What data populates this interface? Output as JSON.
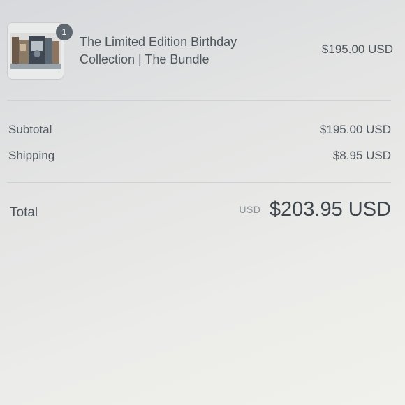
{
  "order_summary": {
    "item": {
      "quantity": "1",
      "title_line1": "The Limited Edition Birthday",
      "title_line2": "Collection | The Bundle",
      "price": "$195.00 USD"
    },
    "subtotal": {
      "label": "Subtotal",
      "value": "$195.00 USD"
    },
    "shipping": {
      "label": "Shipping",
      "value": "$8.95 USD"
    },
    "total": {
      "label": "Total",
      "currency": "USD",
      "value": "$203.95 USD"
    }
  }
}
